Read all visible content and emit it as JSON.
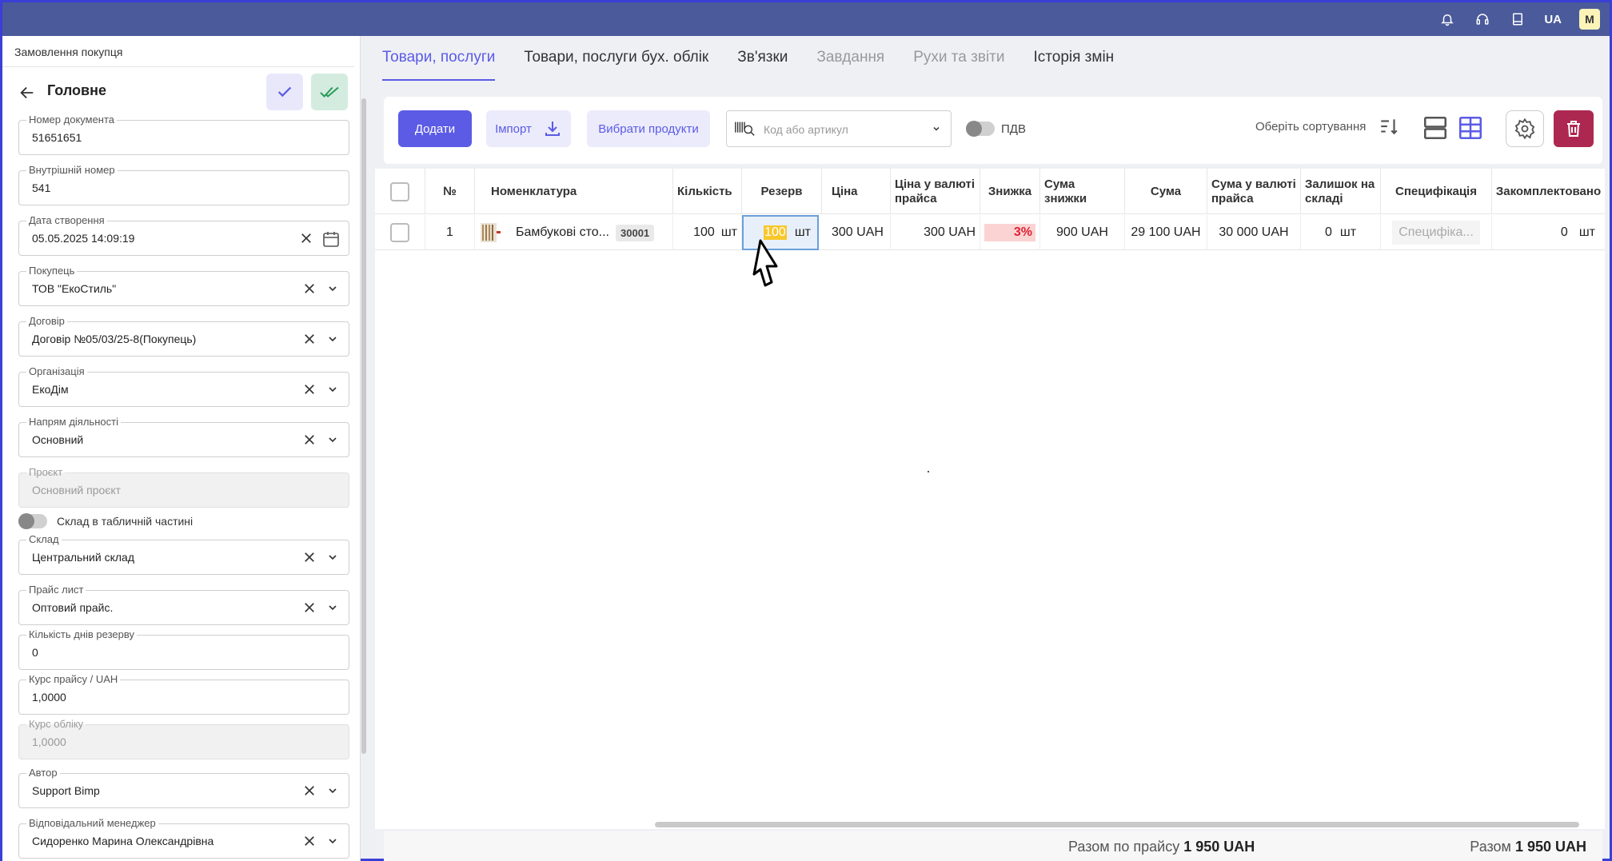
{
  "topbar": {
    "language": "UA",
    "avatar_initial": "M",
    "icons": [
      "bell-icon",
      "headset-icon",
      "book-icon"
    ]
  },
  "sidebar": {
    "breadcrumb": "Замовлення покупця",
    "title": "Головне",
    "fields": {
      "doc_number": {
        "label": "Номер документа",
        "value": "51651651"
      },
      "internal_number": {
        "label": "Внутрішній номер",
        "value": "541"
      },
      "created_date": {
        "label": "Дата створення",
        "value": "05.05.2025 14:09:19"
      },
      "buyer": {
        "label": "Покупець",
        "value": "ТОВ \"ЕкоСтиль\""
      },
      "contract": {
        "label": "Договір",
        "value": "Договір №05/03/25-8(Покупець)"
      },
      "organization": {
        "label": "Організація",
        "value": "ЕкоДім"
      },
      "direction": {
        "label": "Напрям діяльності",
        "value": "Основний"
      },
      "project": {
        "label": "Проєкт",
        "value": "Основний проєкт"
      },
      "warehouse": {
        "label": "Склад",
        "value": "Центральний склад"
      },
      "price_list": {
        "label": "Прайс лист",
        "value": "Оптовий прайс."
      },
      "reserve_days": {
        "label": "Кількість днів резерву",
        "value": "0"
      },
      "price_rate": {
        "label": "Курс прайсу / UAH",
        "value": "1,0000"
      },
      "account_rate": {
        "label": "Курс обліку",
        "value": "1,0000"
      },
      "author": {
        "label": "Автор",
        "value": "Support Bimp"
      },
      "manager": {
        "label": "Відповідальний менеджер",
        "value": "Сидоренко Марина Олександрівна"
      }
    },
    "toggle_label": "Склад в табличній частині"
  },
  "tabs": [
    {
      "label": "Товари, послуги"
    },
    {
      "label": "Товари, послуги бух. облік"
    },
    {
      "label": "Зв'язки"
    },
    {
      "label": "Завдання"
    },
    {
      "label": "Рухи та звіти"
    },
    {
      "label": "Історія змін"
    }
  ],
  "toolbar": {
    "add_label": "Додати",
    "import_label": "Імпорт",
    "choose_label": "Вибрати продукти",
    "search_placeholder": "Код або артикул",
    "vat_label": "ПДВ",
    "sort_label": "Оберіть сортування"
  },
  "table": {
    "headers": {
      "num": "№",
      "name": "Номенклатура",
      "qty": "Кількість",
      "reserve": "Резерв",
      "price": "Ціна",
      "price_currency": "Ціна у валюті прайса",
      "discount": "Знижка",
      "discount_sum": "Сума знижки",
      "sum": "Сума",
      "sum_currency": "Сума у валюті прайса",
      "stock": "Залишок на складі",
      "spec": "Специфікація",
      "assembled": "Закомплектовано"
    },
    "rows": [
      {
        "num": "1",
        "name": "Бамбукові сто...",
        "code": "30001",
        "qty": "100",
        "qty_unit": "шт",
        "reserve": "100",
        "reserve_unit": "шт",
        "price": "300 UAH",
        "price_currency": "300 UAH",
        "discount": "3%",
        "discount_sum": "900  UAH",
        "sum": "29 100  UAH",
        "sum_currency": "30 000  UAH",
        "stock": "0",
        "stock_unit": "шт",
        "spec_placeholder": "Специфіка...",
        "assembled": "0",
        "assembled_unit": "шт"
      }
    ]
  },
  "footer": {
    "total_price_label": "Разом по прайсу",
    "total_price_value": "1 950 UAH",
    "total_label": "Разом",
    "total_value": "1 950 UAH"
  },
  "colors": {
    "accent": "#5b5be6",
    "topbar": "#4a5a9a",
    "delete": "#ad2851",
    "confirm": "#d3ecdf"
  }
}
